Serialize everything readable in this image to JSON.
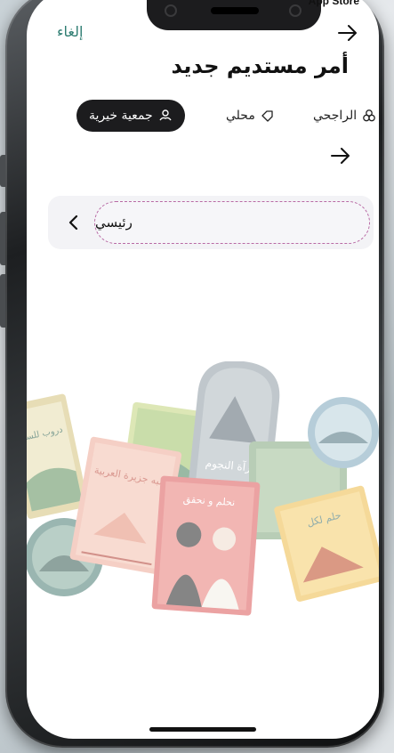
{
  "status": {
    "right_text": "App Store",
    "left_text": "' •"
  },
  "header": {
    "cancel_label": "إلغاء"
  },
  "title": "أمر مستديم جديد",
  "tabs": [
    {
      "label": "جمعية خيرية",
      "icon": "hands-heart-icon",
      "active": true
    },
    {
      "label": "محلي",
      "icon": "tag-icon",
      "active": false
    },
    {
      "label": "الراجحي",
      "icon": "bank-logo-icon",
      "active": false
    }
  ],
  "account_select": {
    "value": "رئيسي"
  },
  "colors": {
    "accent": "#2e7d72",
    "active_tab_bg": "#1c1c1e",
    "dashed_border": "#b86aa5",
    "select_bg": "#f3f3f6"
  },
  "collage": {
    "stamp_left_text": "دروب للسلام",
    "stamp_pink_text": "شبه جزيرة العربية",
    "stamp_gray_text": "مرآة النجوم",
    "stamp_red_text": "نحلم و نحقق",
    "stamp_right_text": "حلم لكل"
  }
}
